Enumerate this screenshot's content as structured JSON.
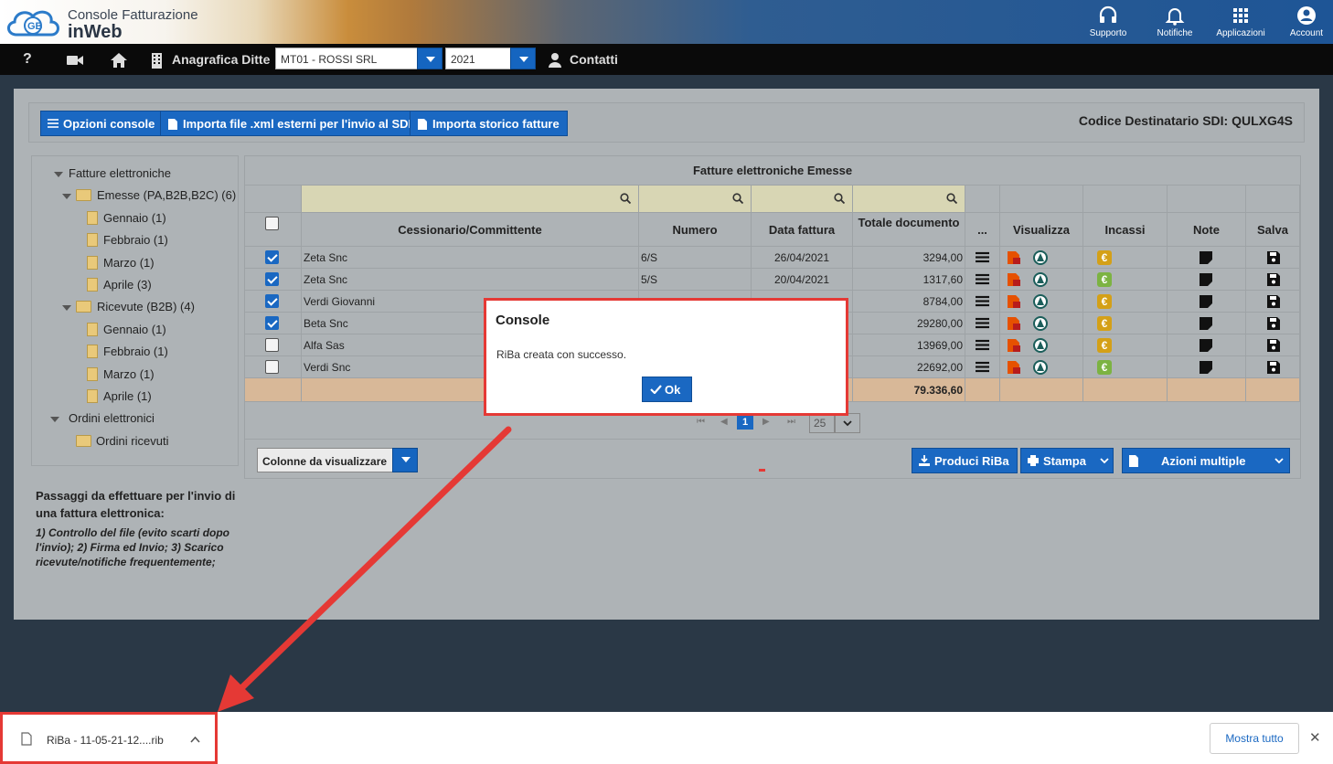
{
  "header": {
    "title": "Console Fatturazione",
    "subtitle": "inWeb",
    "logo_text": "GB",
    "buttons": [
      {
        "label": "Supporto",
        "icon": "headset-icon"
      },
      {
        "label": "Notifiche",
        "icon": "bell-icon"
      },
      {
        "label": "Applicazioni",
        "icon": "apps-grid-icon"
      },
      {
        "label": "Account",
        "icon": "account-icon"
      }
    ]
  },
  "nav": {
    "help": "?",
    "anagrafica": "Anagrafica Ditte",
    "company": "MT01 - ROSSI SRL",
    "year": "2021",
    "contatti": "Contatti"
  },
  "toolbar": {
    "opzioni": "Opzioni console",
    "importa_xml": "Importa file .xml esterni per l'invio al SDI",
    "importa_storico": "Importa storico fatture",
    "codice": "Codice Destinatario SDI: QULXG4S"
  },
  "tree": [
    {
      "label": "Fatture elettroniche",
      "type": "root"
    },
    {
      "label": "Emesse (PA,B2B,B2C) (6)",
      "type": "folder"
    },
    {
      "label": "Gennaio (1)",
      "type": "month"
    },
    {
      "label": "Febbraio (1)",
      "type": "month"
    },
    {
      "label": "Marzo (1)",
      "type": "month"
    },
    {
      "label": "Aprile (3)",
      "type": "month"
    },
    {
      "label": "Ricevute (B2B) (4)",
      "type": "folder"
    },
    {
      "label": "Gennaio (1)",
      "type": "month"
    },
    {
      "label": "Febbraio (1)",
      "type": "month"
    },
    {
      "label": "Marzo (1)",
      "type": "month"
    },
    {
      "label": "Aprile (1)",
      "type": "month"
    },
    {
      "label": "Ordini elettronici",
      "type": "root"
    },
    {
      "label": "Ordini ricevuti",
      "type": "folder2"
    }
  ],
  "steps": {
    "title": "Passaggi da effettuare per l'invio di una fattura elettronica:",
    "body": "1) Controllo del file (evito scarti dopo l'invio); 2) Firma ed Invio; 3) Scarico ricevute/notifiche frequentemente;"
  },
  "grid": {
    "title": "Fatture elettroniche Emesse",
    "columns": {
      "cessionario": "Cessionario/Committente",
      "numero": "Numero",
      "data": "Data fattura",
      "totale": "Totale documento",
      "menu": "...",
      "visualizza": "Visualizza",
      "incassi": "Incassi",
      "note": "Note",
      "salva": "Salva"
    },
    "rows": [
      {
        "checked": true,
        "cessionario": "Zeta Snc",
        "numero": "6/S",
        "data": "26/04/2021",
        "totale": "3294,00",
        "incasso": "#d4a017"
      },
      {
        "checked": true,
        "cessionario": "Zeta Snc",
        "numero": "5/S",
        "data": "20/04/2021",
        "totale": "1317,60",
        "incasso": "#7cb342"
      },
      {
        "checked": true,
        "cessionario": "Verdi Giovanni",
        "numero": "",
        "data": "",
        "totale": "8784,00",
        "incasso": "#d4a017"
      },
      {
        "checked": true,
        "cessionario": "Beta Snc",
        "numero": "",
        "data": "",
        "totale": "29280,00",
        "incasso": "#d4a017"
      },
      {
        "checked": false,
        "cessionario": "Alfa Sas",
        "numero": "",
        "data": "",
        "totale": "13969,00",
        "incasso": "#d4a017"
      },
      {
        "checked": false,
        "cessionario": "Verdi Snc",
        "numero": "",
        "data": "",
        "totale": "22692,00",
        "incasso": "#7cb342"
      }
    ],
    "total": "79.336,60",
    "pager": {
      "page": "1",
      "size": "25"
    }
  },
  "bottom": {
    "colonne": "Colonne da visualizzare",
    "riba": "Produci RiBa",
    "stampa": "Stampa",
    "azioni": "Azioni multiple"
  },
  "modal": {
    "title": "Console",
    "message": "RiBa creata con successo.",
    "ok": "Ok"
  },
  "download": {
    "file": "RiBa - 11-05-21-12....rib",
    "show_all": "Mostra tutto",
    "close": "✕"
  }
}
